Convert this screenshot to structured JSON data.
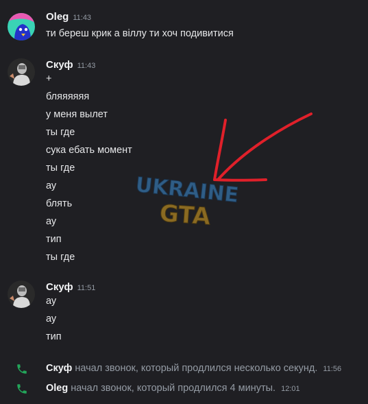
{
  "messages": [
    {
      "author": "Oleg",
      "time": "11:43",
      "lines": [
        "ти береш крик  а віллу ти хоч подивитися"
      ]
    },
    {
      "author": "Скуф",
      "time": "11:43",
      "lines": [
        "+",
        "бляяяяяя",
        "у меня вылет",
        "ты где",
        "сука ебать момент",
        "ты где",
        "ау",
        "блять",
        "ау",
        "тип",
        "ты где"
      ]
    },
    {
      "author": "Скуф",
      "time": "11:51",
      "lines": [
        "ау",
        "ау",
        "тип"
      ]
    }
  ],
  "calls": [
    {
      "author": "Скуф",
      "text": "начал звонок, который продлился несколько секунд.",
      "time": "11:56"
    },
    {
      "author": "Oleg",
      "text": "начал звонок, который продлился 4 минуты.",
      "time": "12:01"
    }
  ],
  "watermark": {
    "line1": "UKRAINE",
    "line2": "GTA"
  },
  "colors": {
    "background": "#1f1f23",
    "call_icon": "#23a55a",
    "annotation_arrow": "#e0202a",
    "watermark_blue": "#2f5d86",
    "watermark_gold": "#8a6a22"
  },
  "icons": {
    "call": "phone-icon",
    "avatar_oleg": "avatar-oleg",
    "avatar_skuf": "avatar-skuf"
  }
}
